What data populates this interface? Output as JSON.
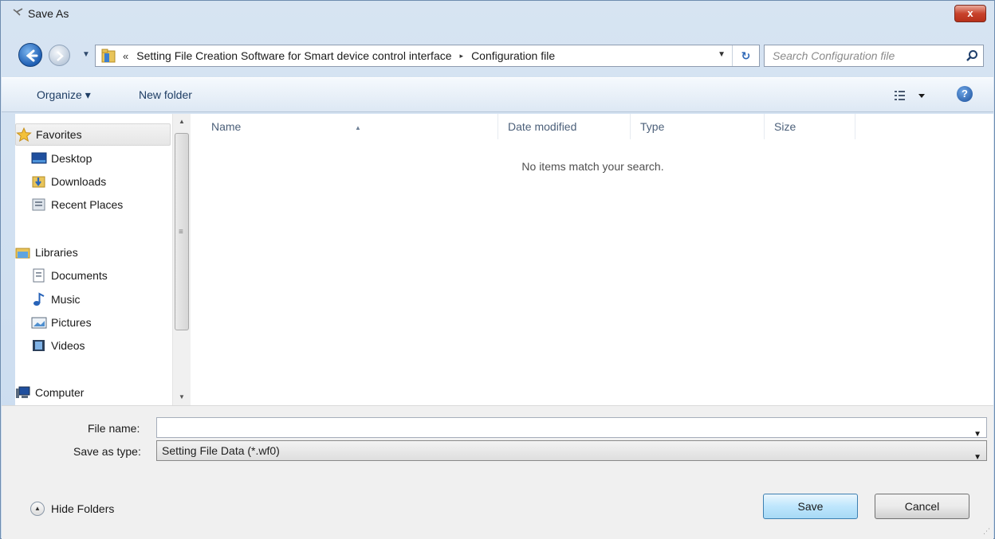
{
  "window": {
    "title": "Save As",
    "close_label": "x"
  },
  "address_bar": {
    "overflow_chevron": "«",
    "segments": [
      "Setting File Creation Software for Smart device control interface",
      "Configuration file"
    ],
    "separator": "▸"
  },
  "search": {
    "placeholder": "Search Configuration file"
  },
  "toolbar": {
    "organize_label": "Organize ▾",
    "new_folder_label": "New folder",
    "help_label": "?"
  },
  "nav_pane": {
    "items": [
      {
        "label": "Favorites",
        "icon": "star-icon",
        "selected": true
      },
      {
        "label": "Desktop",
        "icon": "desktop-icon"
      },
      {
        "label": "Downloads",
        "icon": "downloads-folder-icon"
      },
      {
        "label": "Recent Places",
        "icon": "recent-places-icon"
      },
      {
        "label": "Libraries",
        "icon": "libraries-icon"
      },
      {
        "label": "Documents",
        "icon": "documents-icon"
      },
      {
        "label": "Music",
        "icon": "music-icon"
      },
      {
        "label": "Pictures",
        "icon": "pictures-icon"
      },
      {
        "label": "Videos",
        "icon": "videos-icon"
      },
      {
        "label": "Computer",
        "icon": "computer-icon"
      }
    ]
  },
  "file_list": {
    "columns": [
      "Name",
      "Date modified",
      "Type",
      "Size"
    ],
    "empty_message": "No items match your search."
  },
  "form": {
    "file_name_label": "File name:",
    "file_name_value": "",
    "save_type_label": "Save as type:",
    "save_type_value": "Setting File Data (*.wf0)"
  },
  "footer": {
    "hide_folders_label": "Hide Folders",
    "save_label": "Save",
    "cancel_label": "Cancel"
  },
  "colors": {
    "accent": "#2d67b7",
    "close_red": "#c8432c",
    "save_blue": "#bee6fd"
  }
}
